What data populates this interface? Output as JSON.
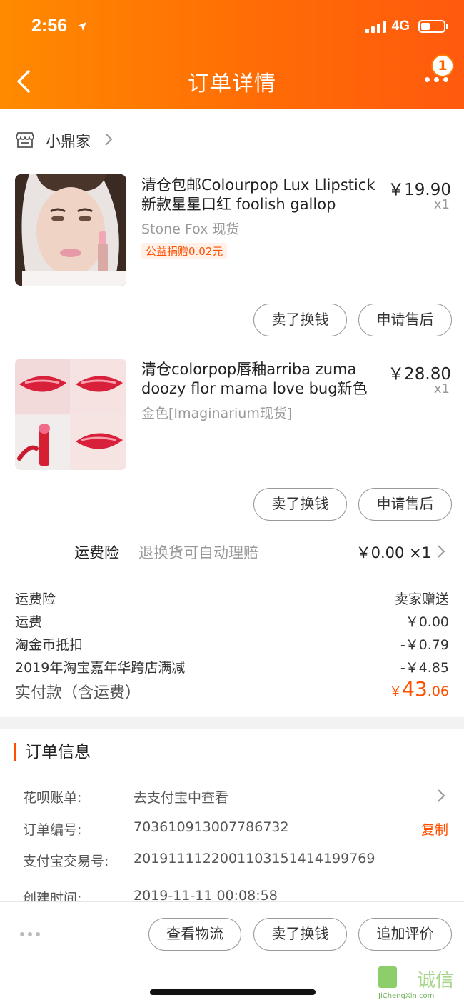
{
  "status_bar": {
    "time": "2:56",
    "network": "4G"
  },
  "header": {
    "title": "订单详情",
    "badge_count": "1"
  },
  "shop": {
    "name": "小鼎家"
  },
  "items": [
    {
      "title": "清仓包邮Colourpop Lux Llipstick 新款星星口红 foolish gallop",
      "price": "￥19.90",
      "qty": "x1",
      "spec": "Stone Fox 现货",
      "tag": "公益捐赠0.02元",
      "buttons": [
        "卖了换钱",
        "申请售后"
      ]
    },
    {
      "title": "清仓colorpop唇釉arriba zuma doozy flor mama love bug新色",
      "price": "￥28.80",
      "qty": "x1",
      "spec": "金色[Imaginarium现货]",
      "buttons": [
        "卖了换钱",
        "申请售后"
      ]
    }
  ],
  "shipping_insurance": {
    "label": "运费险",
    "desc": "退换货可自动理赔",
    "price": "￥0.00 ×1"
  },
  "summary": {
    "rows": [
      {
        "label": "运费险",
        "value": "卖家赠送"
      },
      {
        "label": "运费",
        "value": "￥0.00"
      },
      {
        "label": "淘金币抵扣",
        "value": "-￥0.79"
      },
      {
        "label": "2019年淘宝嘉年华跨店满减",
        "value": "-￥4.85"
      }
    ],
    "paid_label": "实付款（含运费）",
    "paid_currency": "￥",
    "paid_int": "43",
    "paid_dec": ".06"
  },
  "order_info": {
    "title": "订单信息",
    "rows": [
      {
        "label": "花呗账单:",
        "value": "去支付宝中查看"
      },
      {
        "label": "订单编号:",
        "value": "703610913007786732",
        "action": "复制"
      },
      {
        "label": "支付宝交易号:",
        "value": "2019111122001103151414199769"
      },
      {
        "label": "创建时间:",
        "value": "2019-11-11 00:08:58"
      }
    ]
  },
  "bottom_bar": {
    "buttons": [
      "查看物流",
      "卖了换钱",
      "追加评价"
    ]
  },
  "watermark": {
    "main": "集诚信",
    "sub": "JiChengXin.com"
  },
  "colors": {
    "accent": "#ff5000",
    "header_start": "#ff8a00",
    "header_end": "#ff5a0e"
  }
}
